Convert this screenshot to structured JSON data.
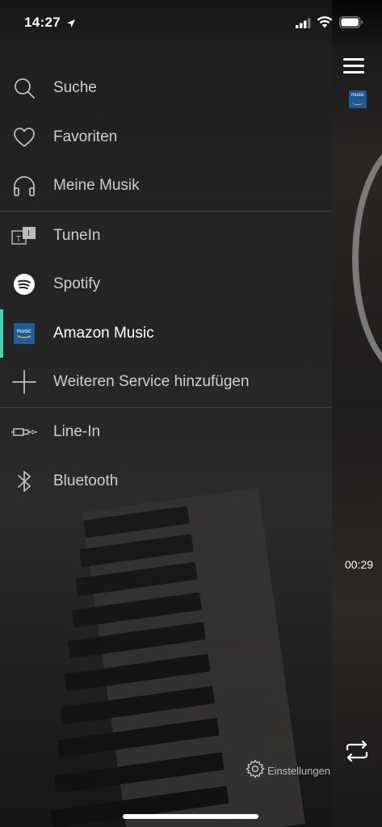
{
  "status_bar": {
    "time": "14:27"
  },
  "menu": {
    "items": [
      {
        "label": "Suche",
        "icon": "search-icon"
      },
      {
        "label": "Favoriten",
        "icon": "heart-icon"
      },
      {
        "label": "Meine Musik",
        "icon": "headphones-icon"
      },
      {
        "label": "TuneIn",
        "icon": "tunein-icon"
      },
      {
        "label": "Spotify",
        "icon": "spotify-icon"
      },
      {
        "label": "Amazon Music",
        "icon": "amazon-music-icon",
        "active": true
      },
      {
        "label": "Weiteren Service hinzufügen",
        "icon": "plus-icon"
      },
      {
        "label": "Line-In",
        "icon": "line-in-icon"
      },
      {
        "label": "Bluetooth",
        "icon": "bluetooth-icon"
      }
    ]
  },
  "settings": {
    "label": "Einstellungen"
  },
  "player": {
    "elapsed": "00:29"
  },
  "amazon_badge": {
    "text": "music"
  },
  "colors": {
    "accent": "#45d3b4",
    "drawer_bg": "#242424",
    "text": "#cfcfcf",
    "active_text": "#ffffff"
  }
}
